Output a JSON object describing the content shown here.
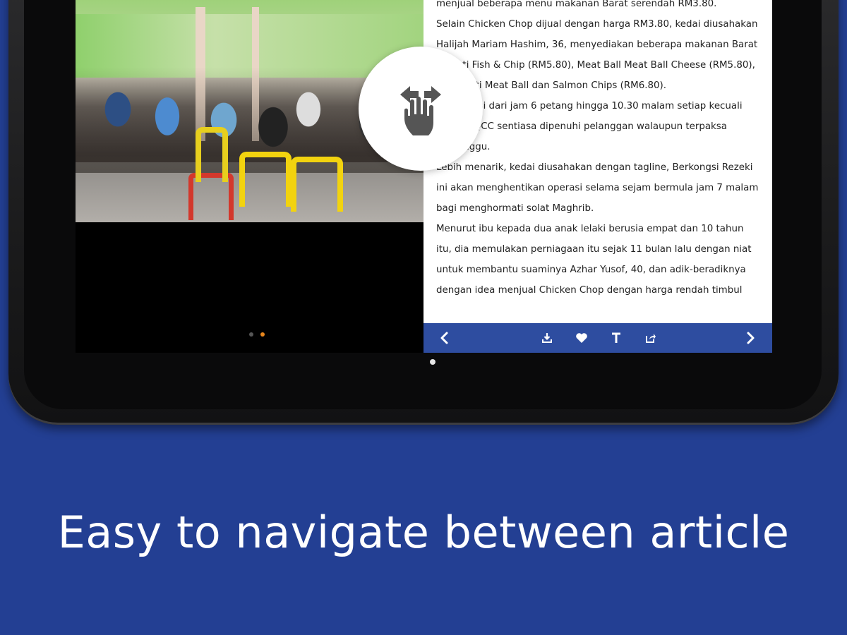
{
  "article": {
    "paragraphs": [
      "menjual beberapa menu makanan Barat serendah RM3.80.",
      "Selain Chicken Chop dijual dengan harga RM3.80, kedai diusahakan Halijah Mariam Hashim, 36, menyediakan beberapa makanan Barat seperti Fish & Chip (RM5.80), Meat Ball Meat Ball Cheese (RM5.80), Spaghetti Meat Ball dan Salmon Chips (RM6.80).",
      "an operasi dari jam 6 petang hingga 10.30 malam setiap kecuali Rabu, NQCC sentiasa dipenuhi pelanggan walaupun terpaksa menunggu.",
      "Lebih menarik, kedai diusahakan dengan tagline, Berkongsi Rezeki ini akan menghentikan operasi selama sejam bermula jam 7 malam bagi menghormati solat Maghrib.",
      "Menurut ibu kepada dua anak lelaki berusia empat dan 10 tahun itu, dia memulakan perniagaan itu sejak 11 bulan lalu dengan niat untuk membantu suaminya Azhar Yusof, 40, dan adik-beradiknya dengan idea menjual Chicken Chop dengan harga rendah timbul"
    ]
  },
  "gallery": {
    "page_count": 2,
    "active_page": 2,
    "dot_inactive_color": "#555555",
    "dot_active_color": "#e8861c"
  },
  "toolbar": {
    "background": "#2e4da0",
    "icons": [
      "chevron-left-icon",
      "download-icon",
      "heart-icon",
      "text-size-icon",
      "share-icon",
      "chevron-right-icon"
    ]
  },
  "gesture_hint": {
    "icon": "swipe-hand-icon"
  },
  "caption": {
    "text": "Easy to navigate between article"
  },
  "colors": {
    "background": "#233f93",
    "caption": "#ffffff"
  }
}
